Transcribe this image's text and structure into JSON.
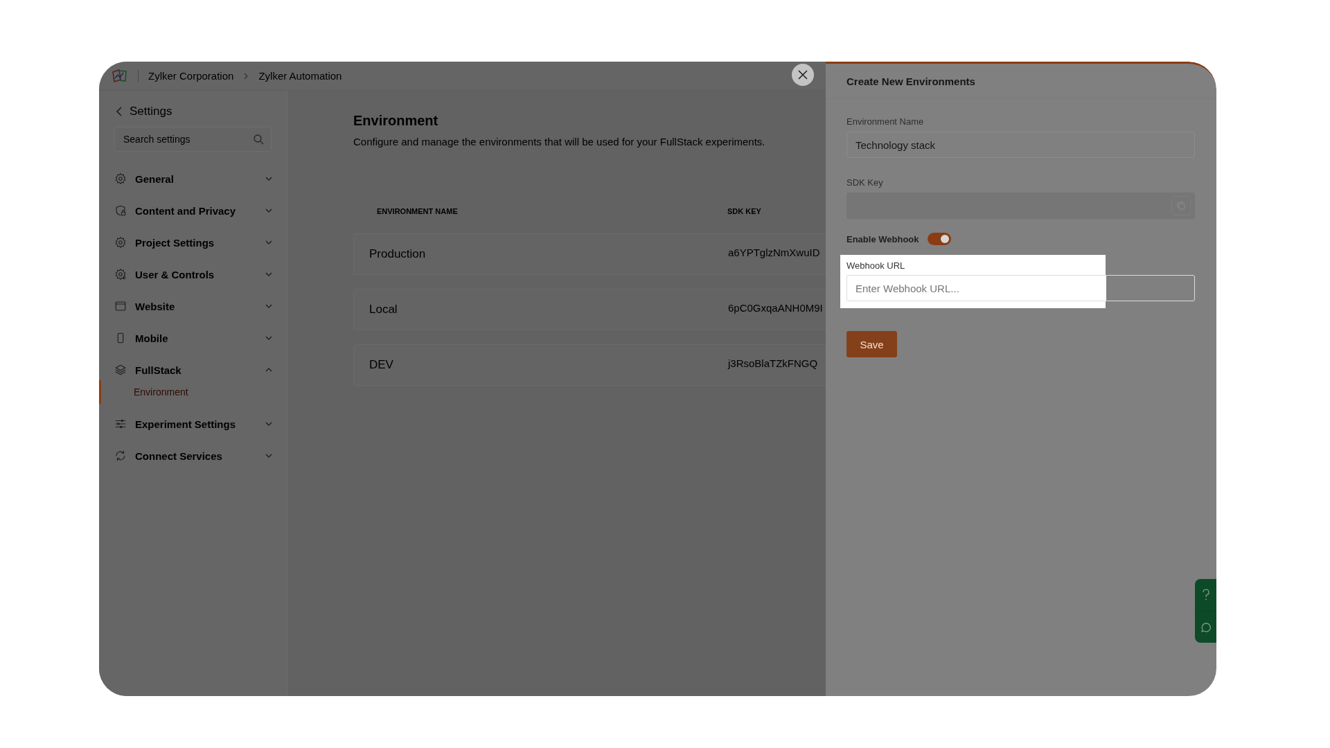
{
  "breadcrumbs": [
    "Zylker Corporation",
    "Zylker Automation"
  ],
  "sidebar": {
    "title": "Settings",
    "search": {
      "placeholder": "Search settings"
    },
    "items": [
      {
        "label": "General",
        "expanded": false
      },
      {
        "label": "Content and Privacy",
        "expanded": false
      },
      {
        "label": "Project Settings",
        "expanded": false
      },
      {
        "label": "User & Controls",
        "expanded": false
      },
      {
        "label": "Website",
        "expanded": false
      },
      {
        "label": "Mobile",
        "expanded": false
      },
      {
        "label": "FullStack",
        "expanded": true,
        "children": [
          {
            "label": "Environment",
            "selected": true
          }
        ]
      },
      {
        "label": "Experiment Settings",
        "expanded": false
      },
      {
        "label": "Connect Services",
        "expanded": false
      }
    ]
  },
  "main": {
    "title": "Environment",
    "description": "Configure and manage the environments that will be used for your FullStack experiments.",
    "table": {
      "columns": [
        "ENVIRONMENT NAME",
        "SDK KEY"
      ],
      "rows": [
        {
          "name": "Production",
          "sdk_key": "a6YPTglzNmXwuID"
        },
        {
          "name": "Local",
          "sdk_key": "6pC0GxqaANH0M9I"
        },
        {
          "name": "DEV",
          "sdk_key": "j3RsoBlaTZkFNGQ"
        }
      ]
    }
  },
  "panel": {
    "title": "Create New Environments",
    "environment_name": {
      "label": "Environment Name",
      "value": "Technology stack"
    },
    "sdk_key": {
      "label": "SDK Key"
    },
    "enable_webhook": {
      "label": "Enable Webhook",
      "on": true
    },
    "webhook_url": {
      "label": "Webhook URL",
      "placeholder": "Enter Webhook URL..."
    },
    "save_button": "Save"
  }
}
